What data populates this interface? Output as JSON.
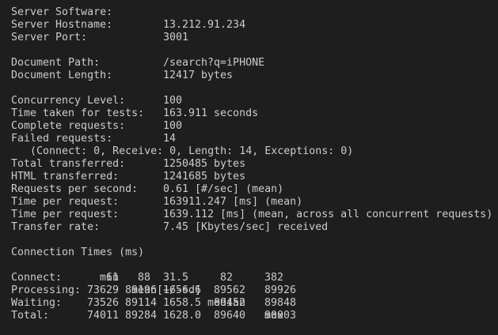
{
  "colors": {
    "background": "#1e1e1e",
    "text": "#cccccc"
  },
  "server": {
    "software": {
      "label": "Server Software:",
      "value": ""
    },
    "hostname": {
      "label": "Server Hostname:",
      "value": "13.212.91.234"
    },
    "port": {
      "label": "Server Port:",
      "value": "3001"
    }
  },
  "document": {
    "path": {
      "label": "Document Path:",
      "value": "/search?q=iPHONE"
    },
    "length": {
      "label": "Document Length:",
      "value": "12417 bytes"
    }
  },
  "stats": [
    {
      "label": "Concurrency Level:",
      "value": "100"
    },
    {
      "label": "Time taken for tests:",
      "value": "163.911 seconds"
    },
    {
      "label": "Complete requests:",
      "value": "100"
    },
    {
      "label": "Failed requests:",
      "value": "14"
    },
    {
      "label": "",
      "value": ""
    },
    {
      "label": "Total transferred:",
      "value": "1250485 bytes"
    },
    {
      "label": "HTML transferred:",
      "value": "1241685 bytes"
    },
    {
      "label": "Requests per second:",
      "value": "0.61 [#/sec] (mean)"
    },
    {
      "label": "Time per request:",
      "value": "163911.247 [ms] (mean)"
    },
    {
      "label": "Time per request:",
      "value": "1639.112 [ms] (mean, across all concurrent requests)"
    },
    {
      "label": "Transfer rate:",
      "value": "7.45 [Kbytes/sec] received"
    }
  ],
  "failed_detail": "   (Connect: 0, Receive: 0, Length: 14, Exceptions: 0)",
  "connection_times": {
    "title": "Connection Times (ms)",
    "headers": [
      "min",
      "mean[+/-sd]",
      "median",
      "max"
    ],
    "rows": [
      {
        "label": "Connect:",
        "min": "61",
        "mean": "88",
        "sd": "31.5",
        "median": "82",
        "max": "382"
      },
      {
        "label": "Processing:",
        "min": "73629",
        "mean": "89196",
        "sd": "1656.6",
        "median": "89562",
        "max": "89926"
      },
      {
        "label": "Waiting:",
        "min": "73526",
        "mean": "89114",
        "sd": "1658.5",
        "median": "89452",
        "max": "89848"
      },
      {
        "label": "Total:",
        "min": "74011",
        "mean": "89284",
        "sd": "1628.0",
        "median": "89640",
        "max": "90003"
      }
    ]
  }
}
